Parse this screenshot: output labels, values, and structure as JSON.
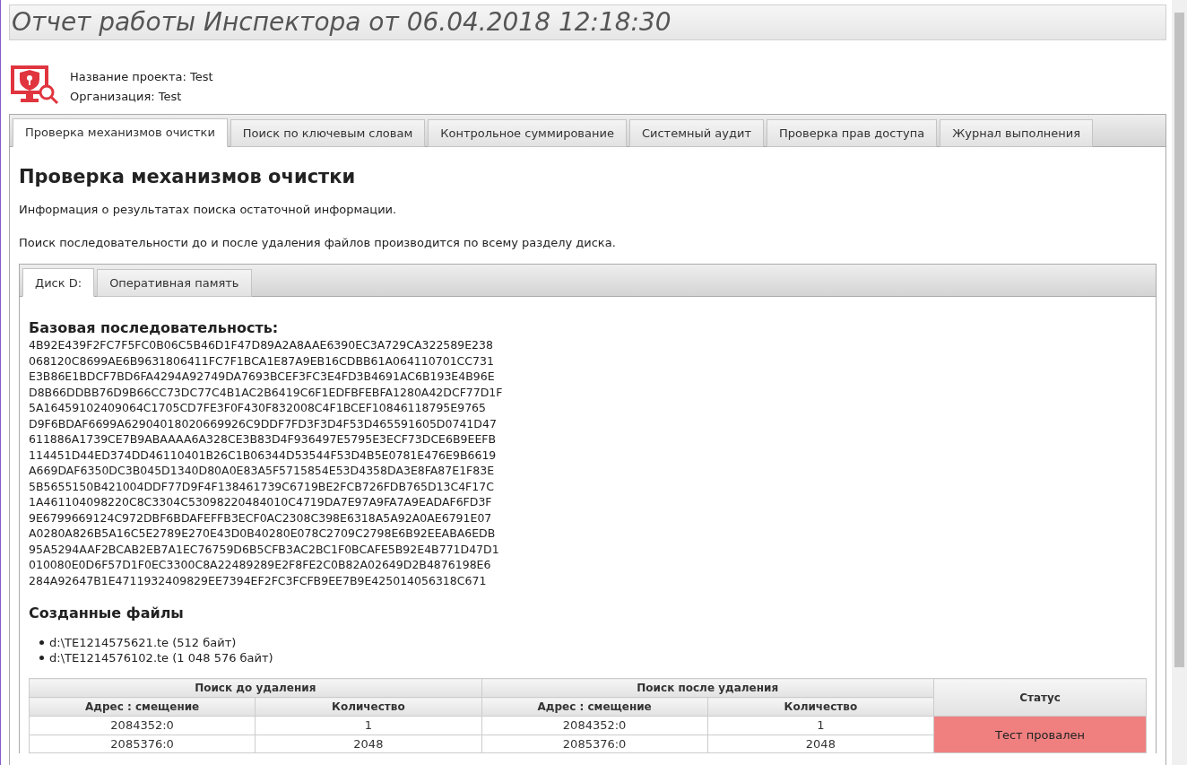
{
  "title": "Отчет работы Инспектора от 06.04.2018 12:18:30",
  "project": [
    {
      "label": "Название проекта:",
      "value": "Test"
    },
    {
      "label": "Организация:",
      "value": "Test"
    }
  ],
  "tabs": [
    {
      "label": "Проверка механизмов очистки",
      "selected": true
    },
    {
      "label": "Поиск по ключевым словам",
      "selected": false
    },
    {
      "label": "Контрольное суммирование",
      "selected": false
    },
    {
      "label": "Системный аудит",
      "selected": false
    },
    {
      "label": "Проверка прав доступа",
      "selected": false
    },
    {
      "label": "Журнал выполнения",
      "selected": false
    }
  ],
  "section": {
    "heading": "Проверка механизмов очистки",
    "paragraphs": [
      "Информация о результатах поиска остаточной информации.",
      "Поиск последовательности до и после удаления файлов производится по всему разделу диска."
    ],
    "subtabs": [
      {
        "label": "Диск D:",
        "selected": true
      },
      {
        "label": "Оперативная память",
        "selected": false
      }
    ],
    "base_heading": "Базовая последовательность:",
    "base_lines": [
      "4B92E439F2FC7F5FC0B06C5B46D1F47D89A2A8AAE6390EC3A729CA322589E238",
      "068120C8699AE6B9631806411FC7F1BCA1E87A9EB16CDBB61A064110701CC731",
      "E3B86E1BDCF7BD6FA4294A92749DA7693BCEF3FC3E4FD3B4691AC6B193E4B96E",
      "D8B66DDBB76D9B66CC73DC77C4B1AC2B6419C6F1EDFBFEBFA1280A42DCF77D1F",
      "5A16459102409064C1705CD7FE3F0F430F832008C4F1BCEF10846118795E9765",
      "D9F6BDAF6699A62904018020669926C9DDF7FD3F3D4F53D465591605D0741D47",
      "611886A1739CE7B9ABAAAA6A328CE3B83D4F936497E5795E3ECF73DCE6B9EEFB",
      "114451D44ED374DD46110401B26C1B06344D53544F53D4B5E0781E476E9B6619",
      "A669DAF6350DC3B045D1340D80A0E83A5F5715854E53D4358DA3E8FA87E1F83E",
      "5B5655150B421004DDF77D9F4F138461739C6719BE2FCB726FDB765D13C4F17C",
      "1A461104098220C8C3304C53098220484010C4719DA7E97A9FA7A9EADAF6FD3F",
      "9E6799669124C972DBF6BDAFEFFB3ECF0AC2308C398E6318A5A92A0AE6791E07",
      "A0280A826B5A16C5E2789E270E43D0B40280E078C2709C2798E6B92EEABA6EDB",
      "95A5294AAF2BCAB2EB7A1EC76759D6B5CFB3AC2BC1F0BCAFE5B92E4B771D47D1",
      "010080E0D6F57D1F0EC3300C8A22489289E2F8FE2C0B82A02649D2B4876198E6",
      "284A92647B1E4711932409829EE7394EF2FC3FCFB9EE7B9E425014056318C671"
    ],
    "files_heading": "Созданные файлы",
    "files": [
      "d:\\TE1214575621.te (512 байт)",
      "d:\\TE1214576102.te (1 048 576 байт)"
    ],
    "table": {
      "groups": [
        "Поиск до удаления",
        "Поиск после удаления"
      ],
      "columns": [
        "Адрес : смещение",
        "Количество",
        "Адрес : смещение",
        "Количество"
      ],
      "status_header": "Статус",
      "rows": [
        [
          "2084352:0",
          "1",
          "2084352:0",
          "1"
        ],
        [
          "2085376:0",
          "2048",
          "2085376:0",
          "2048"
        ]
      ],
      "status": {
        "text": "Тест провален",
        "passed": false
      }
    }
  }
}
